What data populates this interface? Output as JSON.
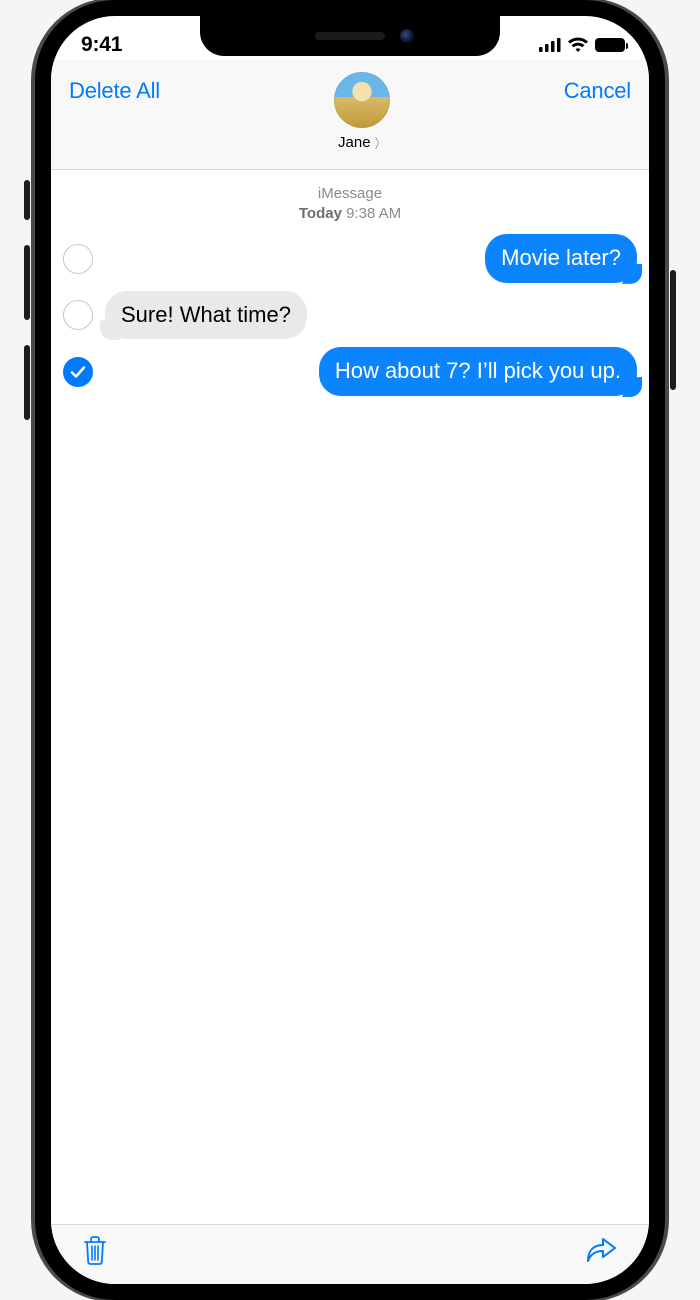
{
  "status": {
    "time": "9:41"
  },
  "nav": {
    "left_label": "Delete All",
    "right_label": "Cancel",
    "contact_name": "Jane"
  },
  "thread": {
    "service_label": "iMessage",
    "timestamp_day": "Today",
    "timestamp_time": "9:38 AM",
    "messages": [
      {
        "from": "me",
        "text": "Movie later?",
        "selected": false
      },
      {
        "from": "them",
        "text": "Sure! What time?",
        "selected": false
      },
      {
        "from": "me",
        "text": "How about 7? I’ll pick you up.",
        "selected": true
      }
    ]
  },
  "colors": {
    "ios_blue": "#007aff",
    "bubble_blue": "#0b84fe",
    "bubble_gray": "#e9e9eb"
  }
}
